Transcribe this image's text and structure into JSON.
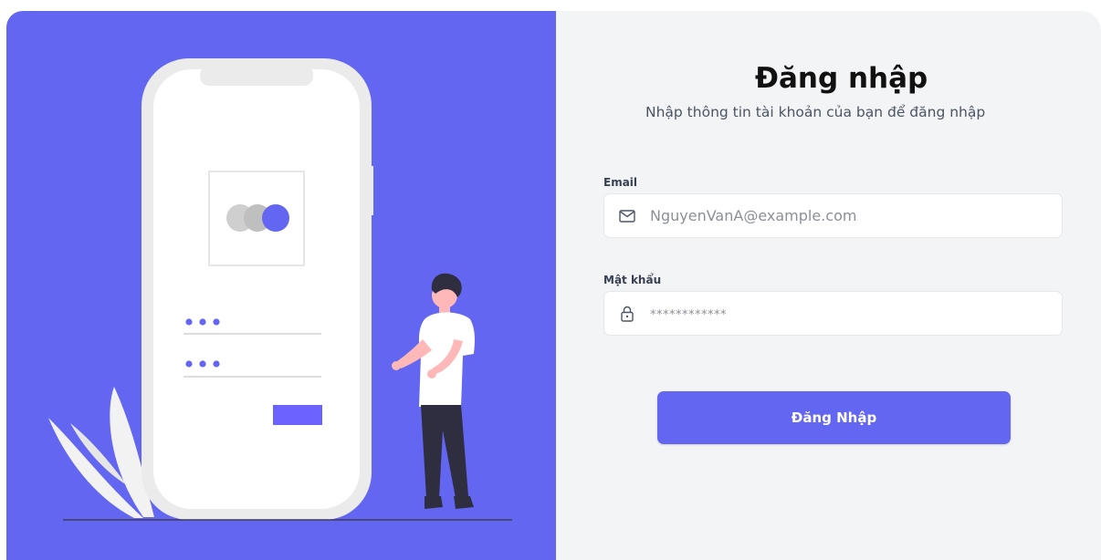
{
  "colors": {
    "accent": "#6366f1",
    "panel_background": "#f3f4f6",
    "illustration_phone": "#ebebeb",
    "illustration_dark": "#2f2e41"
  },
  "illustration": {
    "description_icons": [
      "phone-icon",
      "person-icon",
      "leaf-icon"
    ]
  },
  "header": {
    "title": "Đăng nhập",
    "subtitle": "Nhập thông tin tài khoản của bạn để đăng nhập"
  },
  "form": {
    "email": {
      "label": "Email",
      "placeholder": "NguyenVanA@example.com",
      "value": "",
      "icon": "mail-icon"
    },
    "password": {
      "label": "Mật khẩu",
      "placeholder": "************",
      "value": "",
      "icon": "lock-icon"
    },
    "submit_label": "Đăng Nhập"
  }
}
